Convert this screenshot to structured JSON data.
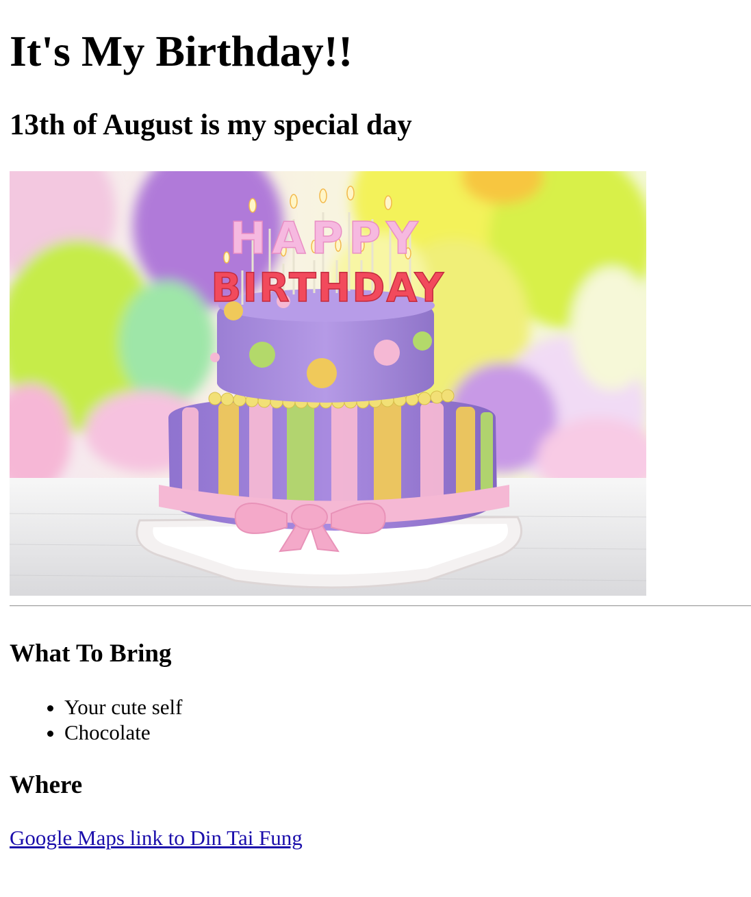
{
  "page": {
    "title": "It's My Birthday!!",
    "subtitle": "13th of August is my special day"
  },
  "hero_image": {
    "topper_line1": "HAPPY",
    "topper_line2": "BIRTHDAY",
    "colors": {
      "balloon_purple": "#b07ad9",
      "balloon_green": "#c6ec4a",
      "balloon_yellow": "#f3f25a",
      "balloon_pink": "#f3b5d0",
      "cake_purple": "#a98be0",
      "ribbon_pink": "#f5b8d4",
      "stripe_yellow": "#f0c95a",
      "stripe_green": "#b3d96a",
      "board_white": "#f4f1f1"
    }
  },
  "sections": {
    "bring": {
      "heading": "What To Bring",
      "items": [
        "Your cute self",
        "Chocolate"
      ]
    },
    "where": {
      "heading": "Where",
      "link_text": "Google Maps link to Din Tai Fung"
    }
  }
}
